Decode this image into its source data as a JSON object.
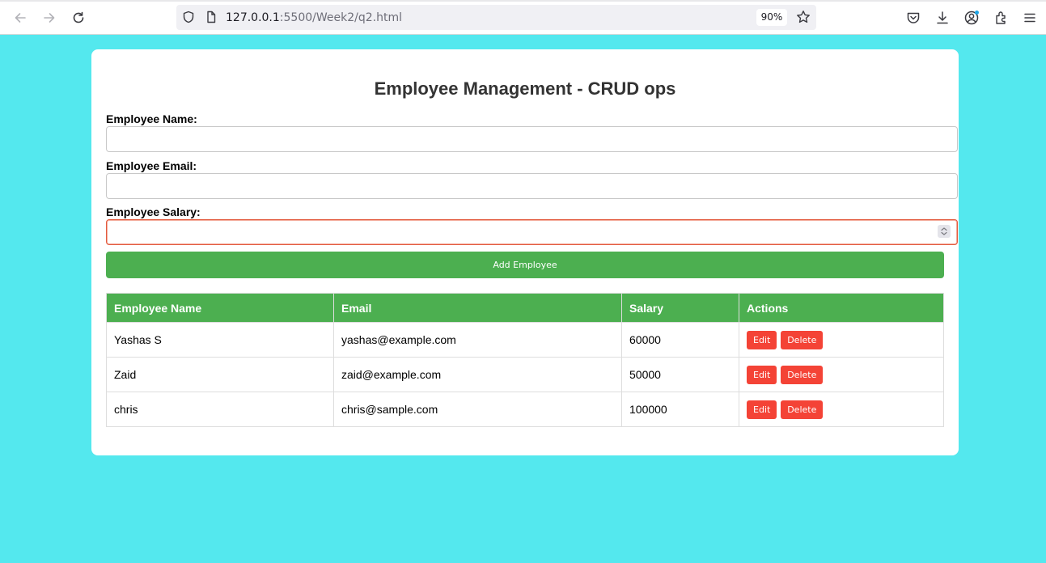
{
  "browser": {
    "url_host": "127.0.0.1",
    "url_path": ":5500/Week2/q2.html",
    "zoom": "90%",
    "icons": [
      "back-arrow-icon",
      "forward-arrow-icon",
      "reload-icon",
      "shield-icon",
      "page-icon",
      "star-icon",
      "pocket-icon",
      "download-icon",
      "account-icon",
      "extensions-icon",
      "menu-icon"
    ]
  },
  "page": {
    "title": "Employee Management - CRUD ops",
    "form": {
      "name_label": "Employee Name:",
      "name_value": "",
      "email_label": "Employee Email:",
      "email_value": "",
      "salary_label": "Employee Salary:",
      "salary_value": "",
      "add_button_label": "Add Employee"
    },
    "table": {
      "headers": [
        "Employee Name",
        "Email",
        "Salary",
        "Actions"
      ],
      "rows": [
        {
          "name": "Yashas S",
          "email": "yashas@example.com",
          "salary": "60000",
          "edit": "Edit",
          "delete": "Delete"
        },
        {
          "name": "Zaid",
          "email": "zaid@example.com",
          "salary": "50000",
          "edit": "Edit",
          "delete": "Delete"
        },
        {
          "name": "chris",
          "email": "chris@sample.com",
          "salary": "100000",
          "edit": "Edit",
          "delete": "Delete"
        }
      ]
    }
  },
  "colors": {
    "background": "#54e8ee",
    "accent_green": "#4caf50",
    "danger_red": "#f44336",
    "card": "#ffffff"
  }
}
